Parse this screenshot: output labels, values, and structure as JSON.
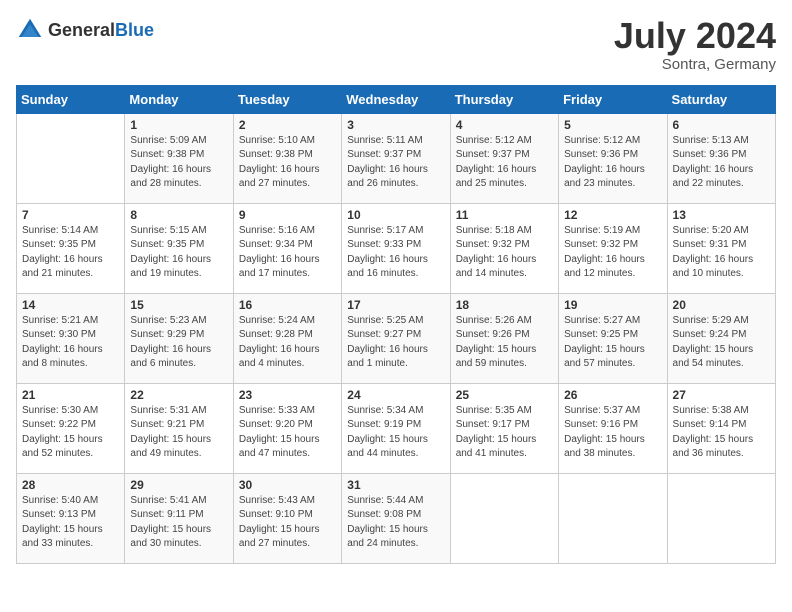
{
  "header": {
    "logo_general": "General",
    "logo_blue": "Blue",
    "month_year": "July 2024",
    "location": "Sontra, Germany"
  },
  "weekdays": [
    "Sunday",
    "Monday",
    "Tuesday",
    "Wednesday",
    "Thursday",
    "Friday",
    "Saturday"
  ],
  "weeks": [
    [
      {
        "day": null
      },
      {
        "day": "1",
        "sunrise": "5:09 AM",
        "sunset": "9:38 PM",
        "daylight": "16 hours and 28 minutes."
      },
      {
        "day": "2",
        "sunrise": "5:10 AM",
        "sunset": "9:38 PM",
        "daylight": "16 hours and 27 minutes."
      },
      {
        "day": "3",
        "sunrise": "5:11 AM",
        "sunset": "9:37 PM",
        "daylight": "16 hours and 26 minutes."
      },
      {
        "day": "4",
        "sunrise": "5:12 AM",
        "sunset": "9:37 PM",
        "daylight": "16 hours and 25 minutes."
      },
      {
        "day": "5",
        "sunrise": "5:12 AM",
        "sunset": "9:36 PM",
        "daylight": "16 hours and 23 minutes."
      },
      {
        "day": "6",
        "sunrise": "5:13 AM",
        "sunset": "9:36 PM",
        "daylight": "16 hours and 22 minutes."
      }
    ],
    [
      {
        "day": "7",
        "sunrise": "5:14 AM",
        "sunset": "9:35 PM",
        "daylight": "16 hours and 21 minutes."
      },
      {
        "day": "8",
        "sunrise": "5:15 AM",
        "sunset": "9:35 PM",
        "daylight": "16 hours and 19 minutes."
      },
      {
        "day": "9",
        "sunrise": "5:16 AM",
        "sunset": "9:34 PM",
        "daylight": "16 hours and 17 minutes."
      },
      {
        "day": "10",
        "sunrise": "5:17 AM",
        "sunset": "9:33 PM",
        "daylight": "16 hours and 16 minutes."
      },
      {
        "day": "11",
        "sunrise": "5:18 AM",
        "sunset": "9:32 PM",
        "daylight": "16 hours and 14 minutes."
      },
      {
        "day": "12",
        "sunrise": "5:19 AM",
        "sunset": "9:32 PM",
        "daylight": "16 hours and 12 minutes."
      },
      {
        "day": "13",
        "sunrise": "5:20 AM",
        "sunset": "9:31 PM",
        "daylight": "16 hours and 10 minutes."
      }
    ],
    [
      {
        "day": "14",
        "sunrise": "5:21 AM",
        "sunset": "9:30 PM",
        "daylight": "16 hours and 8 minutes."
      },
      {
        "day": "15",
        "sunrise": "5:23 AM",
        "sunset": "9:29 PM",
        "daylight": "16 hours and 6 minutes."
      },
      {
        "day": "16",
        "sunrise": "5:24 AM",
        "sunset": "9:28 PM",
        "daylight": "16 hours and 4 minutes."
      },
      {
        "day": "17",
        "sunrise": "5:25 AM",
        "sunset": "9:27 PM",
        "daylight": "16 hours and 1 minute."
      },
      {
        "day": "18",
        "sunrise": "5:26 AM",
        "sunset": "9:26 PM",
        "daylight": "15 hours and 59 minutes."
      },
      {
        "day": "19",
        "sunrise": "5:27 AM",
        "sunset": "9:25 PM",
        "daylight": "15 hours and 57 minutes."
      },
      {
        "day": "20",
        "sunrise": "5:29 AM",
        "sunset": "9:24 PM",
        "daylight": "15 hours and 54 minutes."
      }
    ],
    [
      {
        "day": "21",
        "sunrise": "5:30 AM",
        "sunset": "9:22 PM",
        "daylight": "15 hours and 52 minutes."
      },
      {
        "day": "22",
        "sunrise": "5:31 AM",
        "sunset": "9:21 PM",
        "daylight": "15 hours and 49 minutes."
      },
      {
        "day": "23",
        "sunrise": "5:33 AM",
        "sunset": "9:20 PM",
        "daylight": "15 hours and 47 minutes."
      },
      {
        "day": "24",
        "sunrise": "5:34 AM",
        "sunset": "9:19 PM",
        "daylight": "15 hours and 44 minutes."
      },
      {
        "day": "25",
        "sunrise": "5:35 AM",
        "sunset": "9:17 PM",
        "daylight": "15 hours and 41 minutes."
      },
      {
        "day": "26",
        "sunrise": "5:37 AM",
        "sunset": "9:16 PM",
        "daylight": "15 hours and 38 minutes."
      },
      {
        "day": "27",
        "sunrise": "5:38 AM",
        "sunset": "9:14 PM",
        "daylight": "15 hours and 36 minutes."
      }
    ],
    [
      {
        "day": "28",
        "sunrise": "5:40 AM",
        "sunset": "9:13 PM",
        "daylight": "15 hours and 33 minutes."
      },
      {
        "day": "29",
        "sunrise": "5:41 AM",
        "sunset": "9:11 PM",
        "daylight": "15 hours and 30 minutes."
      },
      {
        "day": "30",
        "sunrise": "5:43 AM",
        "sunset": "9:10 PM",
        "daylight": "15 hours and 27 minutes."
      },
      {
        "day": "31",
        "sunrise": "5:44 AM",
        "sunset": "9:08 PM",
        "daylight": "15 hours and 24 minutes."
      },
      {
        "day": null
      },
      {
        "day": null
      },
      {
        "day": null
      }
    ]
  ]
}
